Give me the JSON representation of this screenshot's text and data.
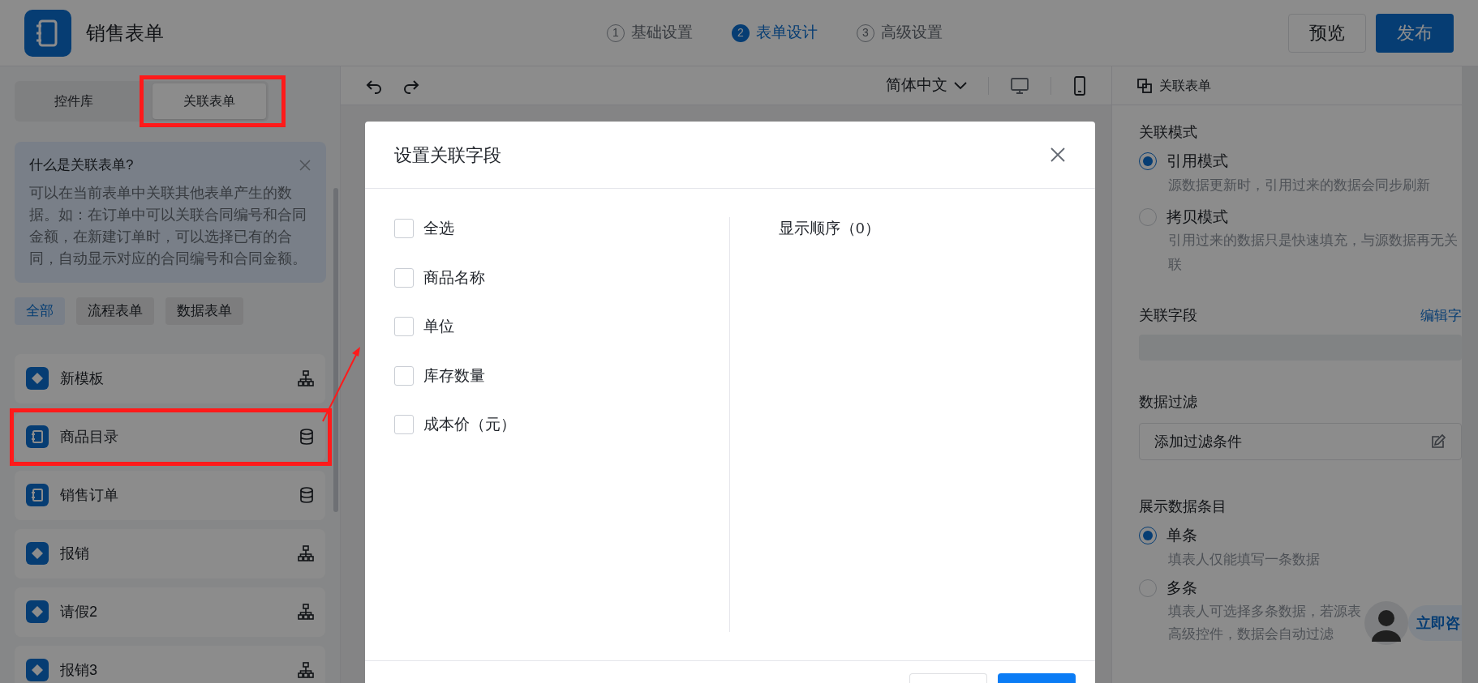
{
  "app": {
    "title": "销售表单"
  },
  "steps": [
    {
      "number": "1",
      "label": "基础设置",
      "selected": false
    },
    {
      "number": "2",
      "label": "表单设计",
      "selected": true
    },
    {
      "number": "3",
      "label": "高级设置",
      "selected": false
    }
  ],
  "header_buttons": [
    {
      "label": "预览",
      "kind": "outline"
    },
    {
      "label": "发布",
      "kind": "primary"
    }
  ],
  "left_panel": {
    "tabs": [
      {
        "label": "控件库",
        "selected": false,
        "highlighted": false
      },
      {
        "label": "关联表单",
        "selected": true,
        "highlighted": true
      }
    ],
    "info": {
      "title": "什么是关联表单?",
      "text": "可以在当前表单中关联其他表单产生的数据。如：在订单中可以关联合同编号和合同金额，在新建订单时，可以选择已有的合同，自动显示对应的合同编号和合同金额。"
    },
    "filters": [
      {
        "label": "全部",
        "selected": true
      },
      {
        "label": "流程表单",
        "selected": false
      },
      {
        "label": "数据表单",
        "selected": false
      }
    ],
    "forms": [
      {
        "name": "新模板",
        "kind": "flow",
        "highlighted": false
      },
      {
        "name": "商品目录",
        "kind": "data",
        "highlighted": true
      },
      {
        "name": "销售订单",
        "kind": "data",
        "highlighted": false
      },
      {
        "name": "报销",
        "kind": "flow",
        "highlighted": false
      },
      {
        "name": "请假2",
        "kind": "flow",
        "highlighted": false
      },
      {
        "name": "报销3",
        "kind": "flow",
        "highlighted": false
      }
    ]
  },
  "canvas_toolbar": {
    "language": "简体中文"
  },
  "right_panel": {
    "title": "关联表单",
    "mode": {
      "label": "关联模式",
      "options": [
        {
          "label": "引用模式",
          "desc": "源数据更新时，引用过来的数据会同步刷新",
          "selected": true
        },
        {
          "label": "拷贝模式",
          "desc": "引用过来的数据只是快速填充，与源数据再无关联",
          "selected": false
        }
      ]
    },
    "fields": {
      "label": "关联字段",
      "link": "编辑字"
    },
    "filter": {
      "label": "数据过滤",
      "placeholder": "添加过滤条件"
    },
    "display": {
      "label": "展示数据条目",
      "options": [
        {
          "label": "单条",
          "desc": "填表人仅能填写一条数据",
          "selected": true
        },
        {
          "label": "多条",
          "desc": "填表人可选择多条数据，若源表",
          "selected": false
        }
      ],
      "note": "高级控件，数据会自动过滤"
    },
    "chat_button": "立即咨"
  },
  "dialog": {
    "title": "设置关联字段",
    "select_all": {
      "label": "全选",
      "checked": false
    },
    "fields": [
      {
        "label": "商品名称",
        "checked": false
      },
      {
        "label": "单位",
        "checked": false
      },
      {
        "label": "库存数量",
        "checked": false
      },
      {
        "label": "成本价（元）",
        "checked": false
      }
    ],
    "order_title": "显示顺序（0）"
  }
}
